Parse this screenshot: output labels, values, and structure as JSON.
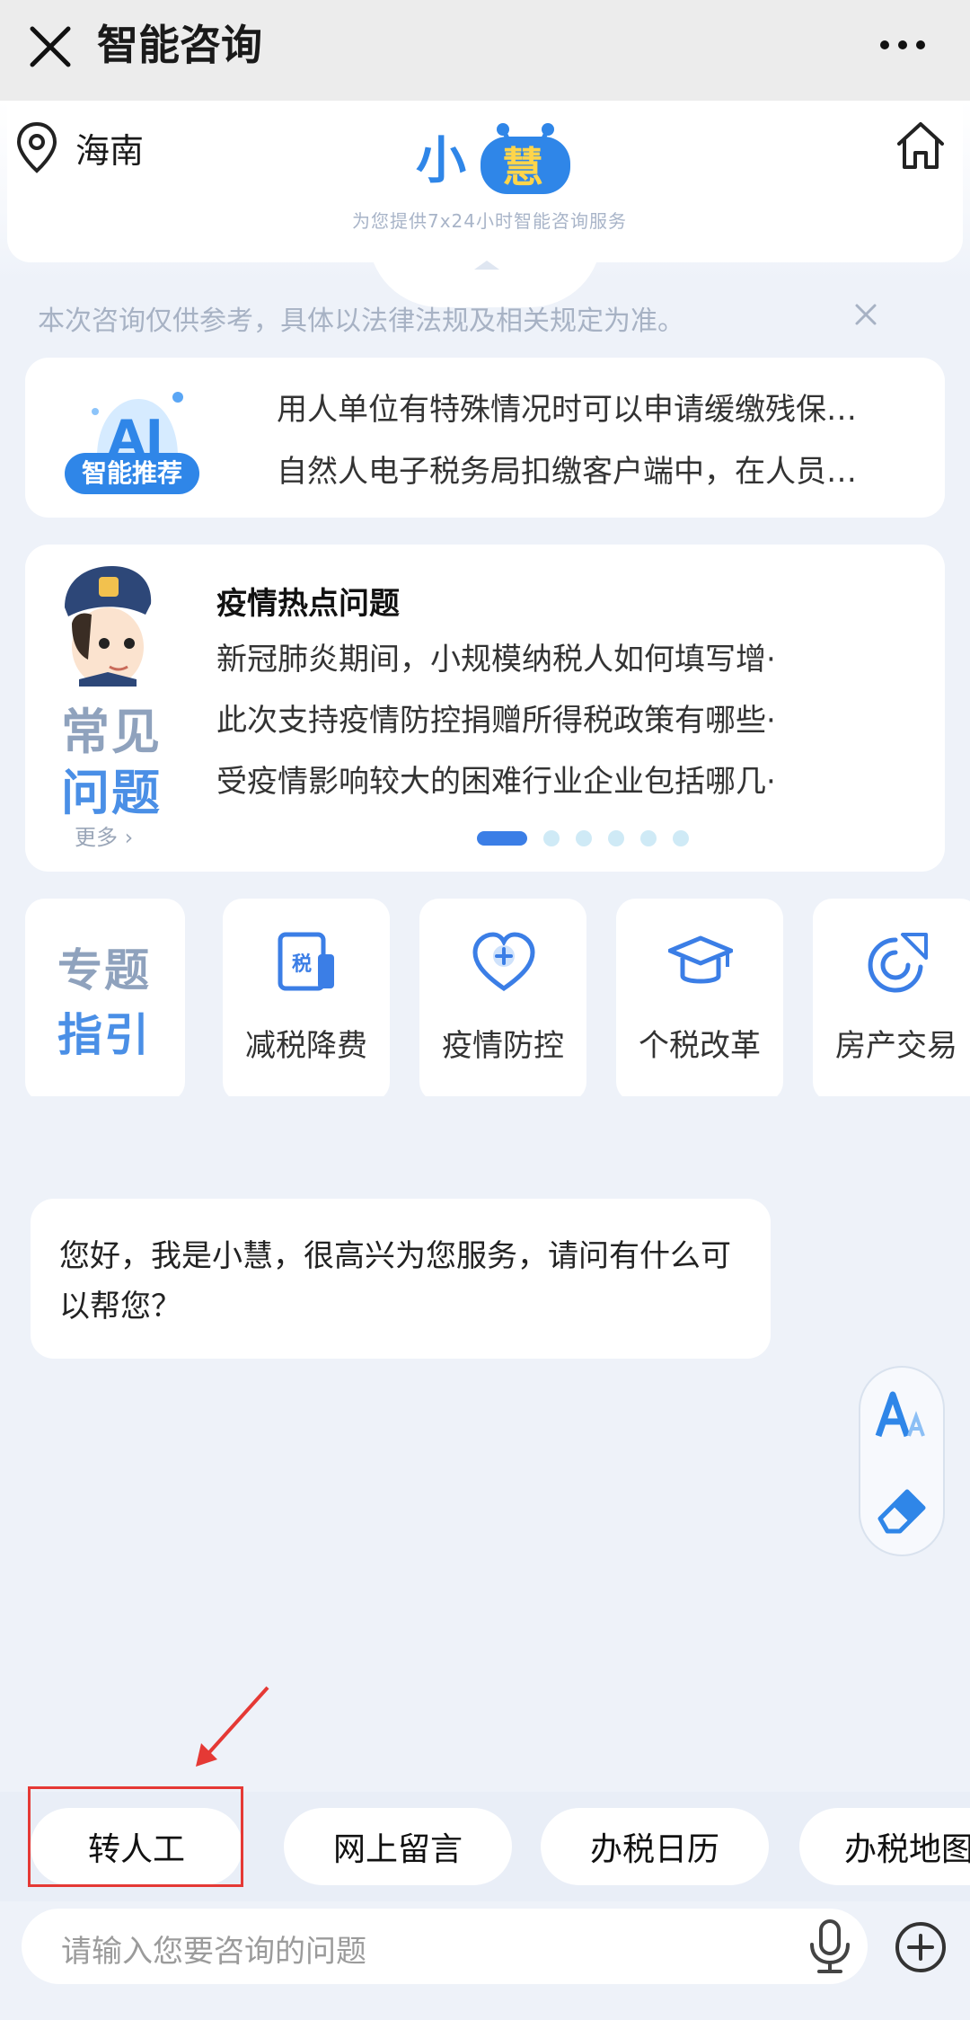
{
  "header": {
    "title": "智能咨询"
  },
  "hero": {
    "location": "海南",
    "logo_text": [
      "小",
      "慧"
    ],
    "slogan": "为您提供7x24小时智能咨询服务"
  },
  "notice": {
    "text": "本次咨询仅供参考，具体以法律法规及相关规定为准。"
  },
  "recommend": {
    "badge_label": "智能推荐",
    "items": [
      "用人单位有特殊情况时可以申请缓缴残保…",
      "自然人电子税务局扣缴客户端中，在人员…"
    ]
  },
  "faq": {
    "big_label_1": "常见",
    "big_label_2": "问题",
    "more": "更多",
    "title": "疫情热点问题",
    "items": [
      "新冠肺炎期间，小规模纳税人如何填写增·",
      "此次支持疫情防控捐赠所得税政策有哪些·",
      "受疫情影响较大的困难行业企业包括哪几·"
    ],
    "page_count": 6,
    "active_page": 1
  },
  "topics": {
    "guide_l1": "专题",
    "guide_l2": "指引",
    "items": [
      {
        "label": "减税降费",
        "icon": "tax-icon"
      },
      {
        "label": "疫情防控",
        "icon": "heart-plus-icon"
      },
      {
        "label": "个税改革",
        "icon": "graduation-cap-icon"
      },
      {
        "label": "房产交易",
        "icon": "pie-chart-icon"
      }
    ],
    "tax_glyph": "税"
  },
  "chat": {
    "greeting": "您好，我是小慧，很高兴为您服务，请问有什么可以帮您？"
  },
  "quick_actions": [
    "转人工",
    "网上留言",
    "办税日历",
    "办税地图"
  ],
  "input": {
    "placeholder": "请输入您要咨询的问题"
  },
  "colors": {
    "accent": "#3b7ee6",
    "highlight": "#e53935",
    "background": "#eef2f9"
  }
}
